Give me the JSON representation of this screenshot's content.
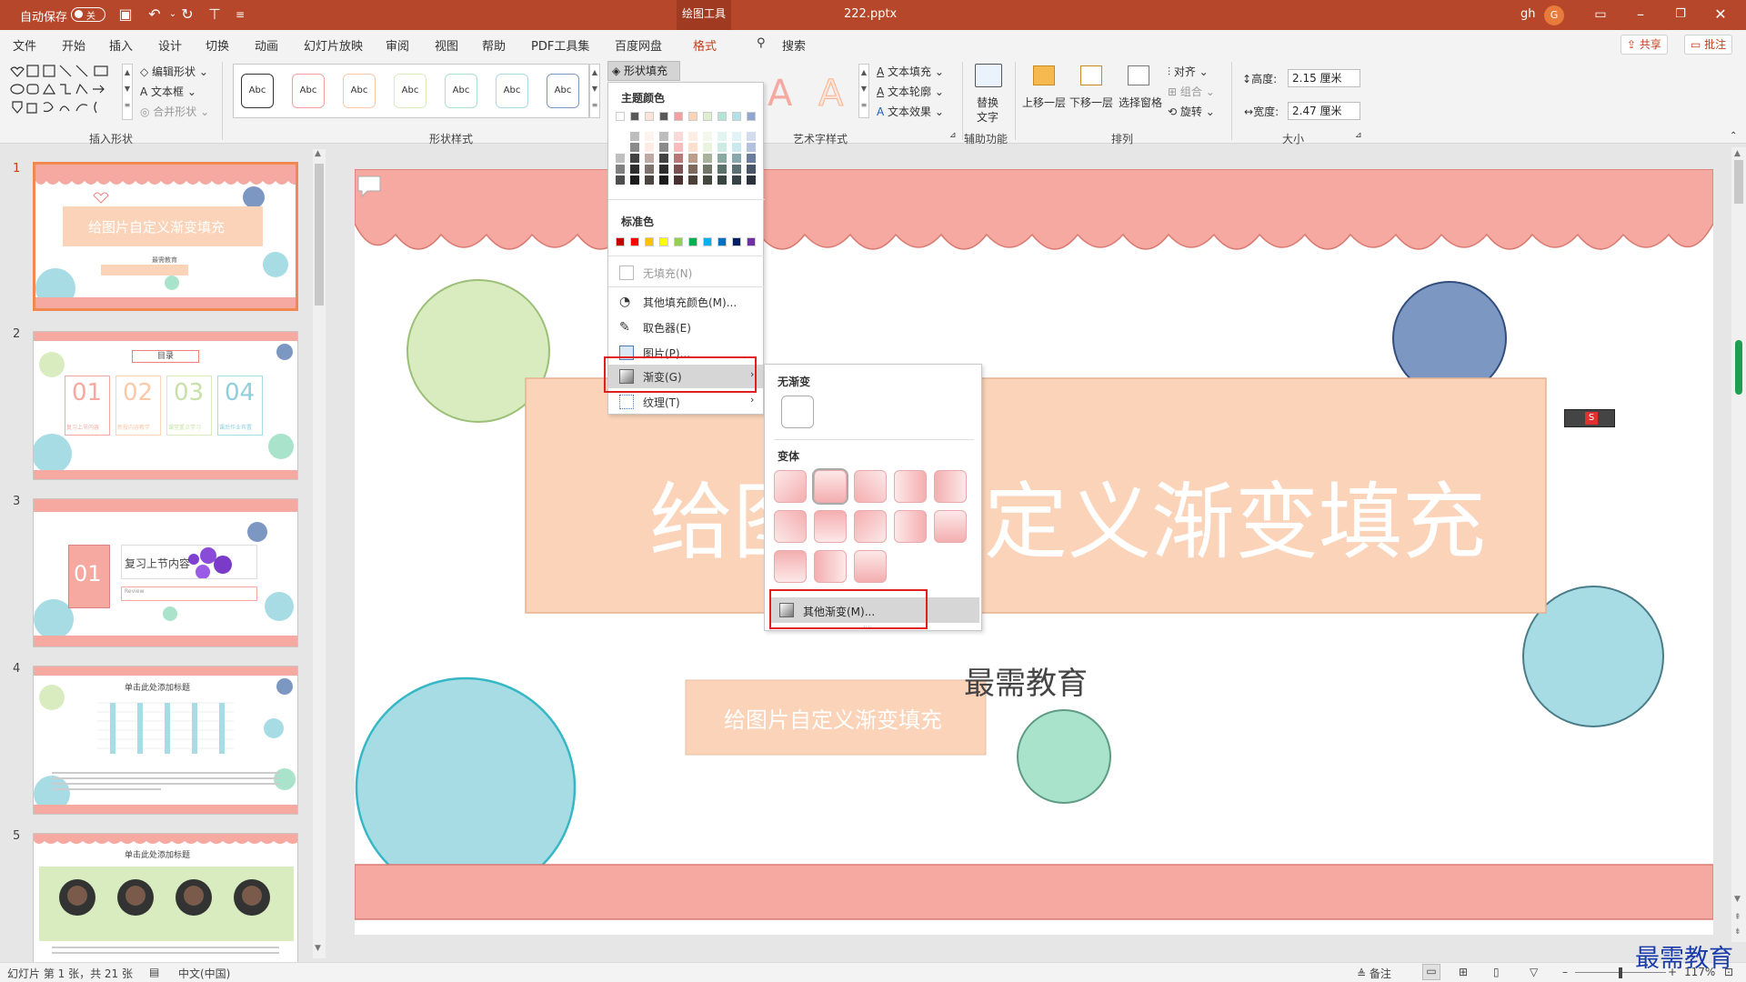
{
  "titlebar": {
    "autosave_label": "自动保存",
    "autosave_state": "关",
    "context_tab": "绘图工具",
    "filename": "222.pptx",
    "user": "gh",
    "avatar_letter": "G"
  },
  "tabs": [
    "文件",
    "开始",
    "插入",
    "设计",
    "切换",
    "动画",
    "幻灯片放映",
    "审阅",
    "视图",
    "帮助",
    "PDF工具集",
    "百度网盘",
    "格式"
  ],
  "active_tab": "格式",
  "search_label": "搜索",
  "share_label": "共享",
  "comment_label": "批注",
  "ribbon": {
    "edit_shape": "编辑形状",
    "text_box": "文本框",
    "merge_shapes": "合并形状",
    "group_insert_shapes": "插入形状",
    "group_shape_styles": "形状样式",
    "style_sample": "Abc",
    "shape_fill": "形状填充",
    "wordart_letter": "A",
    "text_fill": "文本填充",
    "text_outline": "文本轮廓",
    "text_effect": "文本效果",
    "group_wordart": "艺术字样式",
    "alt_text_1": "替换",
    "alt_text_2": "文字",
    "group_accessibility": "辅助功能",
    "bring_forward": "上移一层",
    "send_backward": "下移一层",
    "selection_pane": "选择窗格",
    "align": "对齐",
    "group": "组合",
    "rotate": "旋转",
    "group_arrange": "排列",
    "height_label": "高度:",
    "height_value": "2.15 厘米",
    "width_label": "宽度:",
    "width_value": "2.47 厘米",
    "group_size": "大小"
  },
  "fill_menu": {
    "theme_colors_header": "主题颜色",
    "theme_row": [
      "#ffffff",
      "#595959",
      "#fde3d8",
      "#595959",
      "#f4a0a0",
      "#fbd3b8",
      "#e0eed0",
      "#b6e3d6",
      "#b3e0e8",
      "#8fa7d0"
    ],
    "standard_header": "标准色",
    "standard_colors": [
      "#c00000",
      "#ff0000",
      "#ffc000",
      "#ffff00",
      "#92d050",
      "#00b050",
      "#00b0f0",
      "#0070c0",
      "#002060",
      "#7030a0"
    ],
    "no_fill": "无填充(N)",
    "more_colors": "其他填充颜色(M)...",
    "eyedropper": "取色器(E)",
    "picture": "图片(P)...",
    "gradient": "渐变(G)",
    "texture": "纹理(T)"
  },
  "gradient_menu": {
    "no_gradient": "无渐变",
    "variants": "变体",
    "more_gradients": "其他渐变(M)..."
  },
  "slides": [
    {
      "num": "1",
      "title": "给图片自定义渐变填充",
      "sub": "最需教育"
    },
    {
      "num": "2",
      "title": "目录",
      "items": [
        "01",
        "02",
        "03",
        "04"
      ],
      "captions": [
        "复习上节内容",
        "新授内容教学",
        "课堂重点学习",
        "课后作业布置"
      ]
    },
    {
      "num": "3",
      "num_label": "01",
      "title": "复习上节内容",
      "sub": "Review"
    },
    {
      "num": "4",
      "title": "单击此处添加标题"
    },
    {
      "num": "5",
      "title": "单击此处添加标题"
    }
  ],
  "main_slide": {
    "title": "给图片自定义渐变填充",
    "org": "最需教育",
    "subtitle_box": "给图片自定义渐变填充"
  },
  "status": {
    "slide_info": "幻灯片 第 1 张，共 21 张",
    "language": "中文(中国)",
    "notes": "备注",
    "zoom": "117%"
  },
  "watermark": "最需教育",
  "colors": {
    "accent": "#b7472a",
    "salmon": "#f5a9a0",
    "peach": "#fbd3b8",
    "blue": "#7c97c2",
    "cyan": "#a8dce5",
    "green": "#a9e3cb",
    "lime": "#d8ecc0"
  }
}
